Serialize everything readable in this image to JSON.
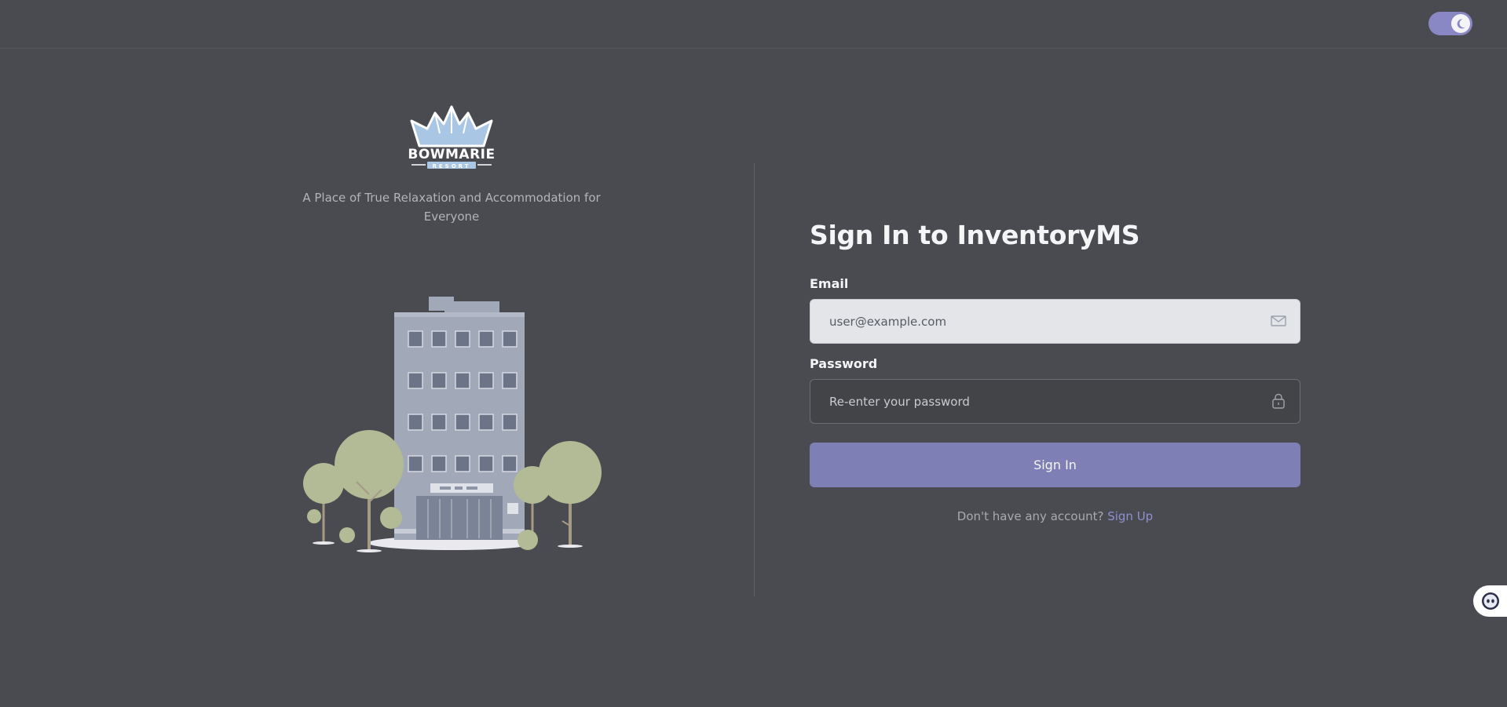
{
  "header": {
    "theme_toggle": {
      "state": "dark",
      "icon": "moon-icon",
      "color": "#8a88c4"
    }
  },
  "brand": {
    "logo_text": "BOWMARIE",
    "logo_subtext": "RESORT",
    "tagline": "A Place of True Relaxation and Accommodation for Everyone"
  },
  "form": {
    "title": "Sign In to InventoryMS",
    "email": {
      "label": "Email",
      "value": "user@example.com",
      "icon": "mail-icon"
    },
    "password": {
      "label": "Password",
      "placeholder": "Re-enter your password",
      "icon": "lock-icon"
    },
    "submit_label": "Sign In",
    "signup_prompt": "Don't have any account?",
    "signup_link": "Sign Up"
  },
  "chat_widget": {
    "icon": "chat-bot-icon"
  },
  "colors": {
    "background": "#4a4b50",
    "accent": "#7d7fb5",
    "link": "#8f8fd0"
  }
}
